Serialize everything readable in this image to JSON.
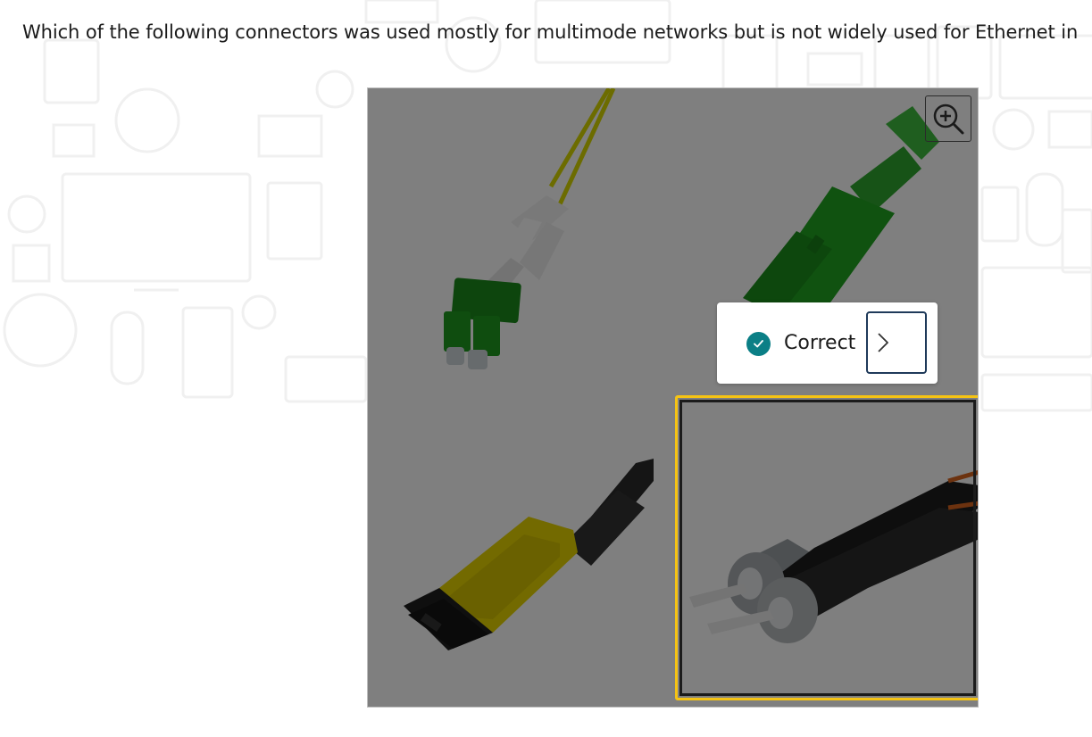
{
  "question": {
    "text": "Which of the following connectors was used mostly for multimode networks but is not widely used for Ethernet in"
  },
  "hotspot": {
    "zoom_icon": "zoom-in-icon",
    "selected_option": "st-connector",
    "options": [
      {
        "name": "lc-connector",
        "icon": "lc-duplex-connector-image"
      },
      {
        "name": "sc-connector",
        "icon": "sc-connector-image"
      },
      {
        "name": "mpo-connector",
        "icon": "mpo-connector-image"
      },
      {
        "name": "st-connector",
        "icon": "st-connector-image"
      }
    ]
  },
  "feedback": {
    "label": "Correct",
    "status_icon": "check-circle-icon",
    "next_icon": "chevron-right-icon"
  },
  "colors": {
    "highlight": "#f5c313",
    "correct": "#0b7f86",
    "next_border": "#1f3a5a"
  }
}
